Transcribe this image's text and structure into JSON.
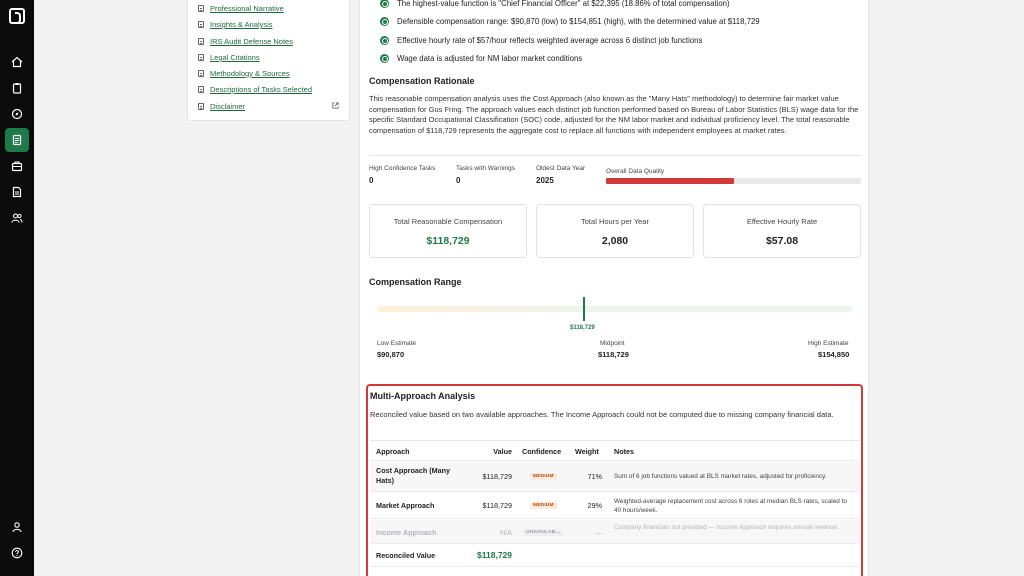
{
  "sidebar_nav": {
    "links": [
      "Professional Narrative",
      "Insights & Analysis",
      "IRS Audit Defense Notes",
      "Legal Citations",
      "Methodology & Sources",
      "Descriptions of Tasks Selected",
      "Disclaimer"
    ]
  },
  "bullets": [
    "The highest-value function is \"Chief Financial Officer\" at $22,395 (18.86% of total compensation)",
    "Defensible compensation range: $90,870 (low) to $154,851 (high), with the determined value at $118,729",
    "Effective hourly rate of $57/hour reflects weighted average across 6 distinct job functions",
    "Wage data is adjusted for NM labor market conditions"
  ],
  "rationale": {
    "title": "Compensation Rationale",
    "text": "This reasonable compensation analysis uses the Cost Approach (also known as the \"Many Hats\" methodology) to determine fair market value compensation for Gus Fring. The approach values each distinct job function performed based on Bureau of Labor Statistics (BLS) wage data for the specific Standard Occupational Classification (SOC) code, adjusted for the NM labor market and individual proficiency level. The total reasonable compensation of $118,729 represents the aggregate cost to replace all functions with independent employees at market rates."
  },
  "stats": {
    "high_conf_label": "High Confidence Tasks",
    "high_conf_value": "0",
    "warnings_label": "Tasks with Warnings",
    "warnings_value": "0",
    "oldest_label": "Oldest Data Year",
    "oldest_value": "2025",
    "quality_label": "Overall Data Quality",
    "quality_fraction": 0.5
  },
  "metrics": {
    "total_comp_label": "Total Reasonable Compensation",
    "total_comp_value": "$118,729",
    "hours_label": "Total Hours per Year",
    "hours_value": "2,080",
    "hourly_label": "Effective Hourly Rate",
    "hourly_value": "$57.08"
  },
  "range": {
    "title": "Compensation Range",
    "marker_label": "$118,729",
    "low_label": "Low Estimate",
    "low_value": "$90,870",
    "mid_label": "Midpoint",
    "mid_value": "$118,729",
    "high_label": "High Estimate",
    "high_value": "$154,850"
  },
  "multi": {
    "title": "Multi-Approach Analysis",
    "desc": "Reconciled value based on two available approaches. The Income Approach could not be computed due to missing company financial data.",
    "headers": {
      "approach": "Approach",
      "value": "Value",
      "confidence": "Confidence",
      "weight": "Weight",
      "notes": "Notes"
    },
    "rows": [
      {
        "approach": "Cost Approach (Many Hats)",
        "value": "$118,729",
        "confidence": "MEDIUM",
        "weight": "71%",
        "notes": "Sum of 6 job functions valued at BLS market rates, adjusted for proficiency."
      },
      {
        "approach": "Market Approach",
        "value": "$118,729",
        "confidence": "MEDIUM",
        "weight": "29%",
        "notes": "Weighted-average replacement cost across 6 roles at median BLS rates, scaled to 40 hours/week."
      },
      {
        "approach": "Income Approach",
        "value": "N/A",
        "confidence": "UNAVAILAB...",
        "weight": "—",
        "notes": "Company financials not provided — Income Approach requires annual revenue."
      }
    ],
    "reconciled_label": "Reconciled Value",
    "reconciled_value": "$118,729"
  },
  "colors": {
    "accent": "#1f7a4a",
    "danger": "#d23a3a",
    "badge": "#b8480c"
  }
}
